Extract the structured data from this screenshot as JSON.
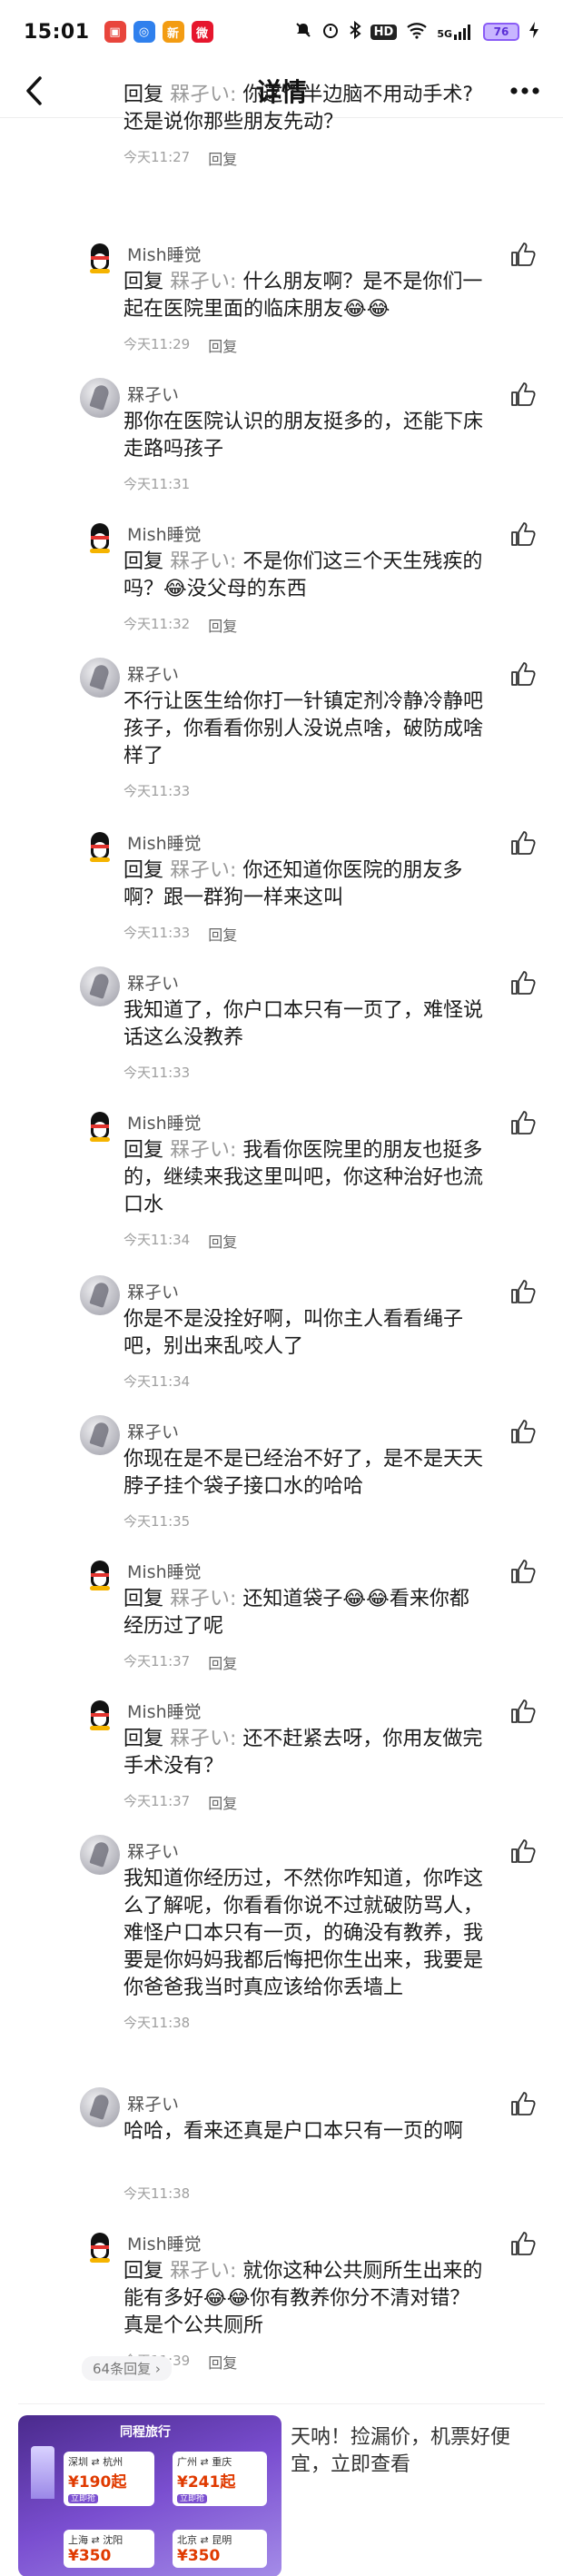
{
  "status_bar": {
    "time": "15:01",
    "apps": [
      {
        "name": "app-red-icon",
        "color": "#e8453c",
        "glyph": "▣"
      },
      {
        "name": "app-blue-icon",
        "color": "#2f80ed",
        "glyph": "◎"
      },
      {
        "name": "app-news-icon",
        "color": "#f39c12",
        "glyph": "新"
      },
      {
        "name": "app-weibo-icon",
        "color": "#e6162d",
        "glyph": "微"
      }
    ],
    "icons": [
      "mute-icon",
      "alarm-icon",
      "bluetooth-icon",
      "hd-icon",
      "wifi-icon",
      "signal-5g-icon",
      "battery-icon",
      "charging-icon"
    ],
    "hd_label": "HD",
    "signal_label": "5G",
    "battery_label": "76"
  },
  "nav": {
    "back_glyph": "‹",
    "title": "详情",
    "more_glyph": "•••"
  },
  "comments": [
    {
      "type": "qq",
      "author": "",
      "reply_to": "槑孑い:",
      "text": "你这个半边脑不用动手术?还是说你那些朋友先动？",
      "time": "今天11:27",
      "reply_label": "回复",
      "show_like": false
    },
    {
      "type": "qq",
      "author": "Mish睡觉",
      "reply_to": "槑孑い:",
      "text": "什么朋友啊？是不是你们一起在医院里面的临床朋友😂😂",
      "time": "今天11:29",
      "reply_label": "回复",
      "show_like": true
    },
    {
      "type": "photo",
      "author": "槑孑い",
      "reply_to": "",
      "text": "那你在医院认识的朋友挺多的，还能下床走路吗孩子",
      "time": "今天11:31",
      "reply_label": "",
      "show_like": true
    },
    {
      "type": "qq",
      "author": "Mish睡觉",
      "reply_to": "槑孑い:",
      "text": "不是你们这三个天生残疾的吗？😂没父母的东西",
      "time": "今天11:32",
      "reply_label": "回复",
      "show_like": true
    },
    {
      "type": "photo",
      "author": "槑孑い",
      "reply_to": "",
      "text": "不行让医生给你打一针镇定剂冷静冷静吧孩子，你看看你别人没说点啥，破防成啥样了",
      "time": "今天11:33",
      "reply_label": "",
      "show_like": true
    },
    {
      "type": "qq",
      "author": "Mish睡觉",
      "reply_to": "槑孑い:",
      "text": "你还知道你医院的朋友多啊？跟一群狗一样来这叫",
      "time": "今天11:33",
      "reply_label": "回复",
      "show_like": true
    },
    {
      "type": "photo",
      "author": "槑孑い",
      "reply_to": "",
      "text": "我知道了，你户口本只有一页了，难怪说话这么没教养",
      "time": "今天11:33",
      "reply_label": "",
      "show_like": true
    },
    {
      "type": "qq",
      "author": "Mish睡觉",
      "reply_to": "槑孑い:",
      "text": "我看你医院里的朋友也挺多的，继续来我这里叫吧，你这种治好也流口水",
      "time": "今天11:34",
      "reply_label": "回复",
      "show_like": true
    },
    {
      "type": "photo",
      "author": "槑孑い",
      "reply_to": "",
      "text": "你是不是没拴好啊，叫你主人看看绳子吧，别出来乱咬人了",
      "time": "今天11:34",
      "reply_label": "",
      "show_like": true
    },
    {
      "type": "photo",
      "author": "槑孑い",
      "reply_to": "",
      "text": "你现在是不是已经治不好了，是不是天天脖子挂个袋子接口水的哈哈",
      "time": "今天11:35",
      "reply_label": "",
      "show_like": true
    },
    {
      "type": "qq",
      "author": "Mish睡觉",
      "reply_to": "槑孑い:",
      "text": "还知道袋子😂😂看来你都经历过了呢",
      "time": "今天11:37",
      "reply_label": "回复",
      "show_like": true
    },
    {
      "type": "qq",
      "author": "Mish睡觉",
      "reply_to": "槑孑い:",
      "text": "还不赶紧去呀，你用友做完手术没有？",
      "time": "今天11:37",
      "reply_label": "回复",
      "show_like": true
    },
    {
      "type": "photo",
      "author": "槑孑い",
      "reply_to": "",
      "text": "我知道你经历过，不然你咋知道，你咋这么了解呢，你看看你说不过就破防骂人，难怪户口本只有一页，的确没有教养，我要是你妈妈我都后悔把你生出来，我要是你爸爸我当时真应该给你丢墙上",
      "time": "今天11:38",
      "reply_label": "",
      "show_like": true
    },
    {
      "type": "photo",
      "author": "槑孑い",
      "reply_to": "",
      "text": "哈哈，看来还真是户口本只有一页的啊",
      "time": "今天11:38",
      "reply_label": "",
      "show_like": true
    },
    {
      "type": "qq",
      "author": "Mish睡觉",
      "reply_to": "槑孑い:",
      "text": "就你这种公共厕所生出来的能有多好😂😂你有教养你分不清对错？真是个公共厕所",
      "time": "今天11:39",
      "reply_label": "回复",
      "show_like": true
    }
  ],
  "reply_prefix": "回复",
  "more_replies": "64条回复 ›",
  "ad": {
    "brand": "同程旅行",
    "cards": [
      {
        "route": "深圳 ⇄ 杭州",
        "price": "¥190起",
        "tag": "立即抢"
      },
      {
        "route": "广州 ⇄ 重庆",
        "price": "¥241起",
        "tag": "立即抢"
      },
      {
        "route": "上海 ⇄ 沈阳",
        "price": "¥350",
        "tag": ""
      },
      {
        "route": "北京 ⇄ 昆明",
        "price": "¥350",
        "tag": ""
      }
    ],
    "text": "天呐！捡漏价，机票好便宜，立即查看"
  },
  "colors": {
    "accent": "#8a5cf6",
    "reply_name": "#9a9a9a",
    "meta": "#9f9f9f"
  }
}
